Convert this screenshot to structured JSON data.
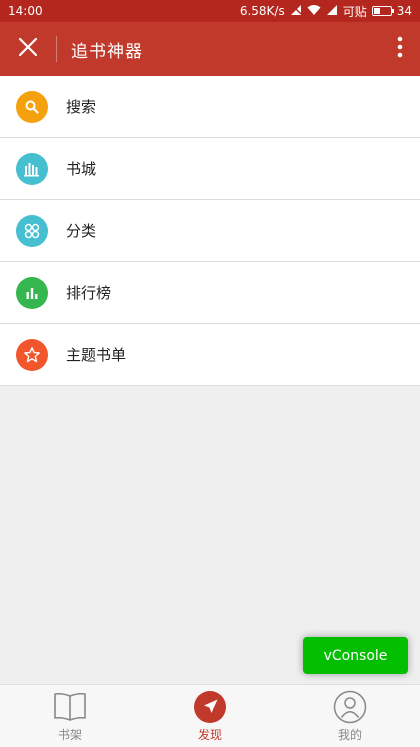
{
  "status_bar": {
    "time": "14:00",
    "net_speed": "6.58K/s",
    "carrier": "可贴",
    "battery": "34"
  },
  "title_bar": {
    "title": "追书神器"
  },
  "menu": {
    "items": [
      {
        "label": "搜索",
        "icon": "search-icon",
        "color": "#f5a10e"
      },
      {
        "label": "书城",
        "icon": "bookstore-icon",
        "color": "#46bfd1"
      },
      {
        "label": "分类",
        "icon": "category-icon",
        "color": "#46bfd1"
      },
      {
        "label": "排行榜",
        "icon": "ranking-icon",
        "color": "#36b64f"
      },
      {
        "label": "主题书单",
        "icon": "star-icon",
        "color": "#f2562d"
      }
    ]
  },
  "vconsole": {
    "label": "vConsole",
    "color": "#04be02"
  },
  "tabs": [
    {
      "label": "书架",
      "icon": "book-icon",
      "active": false
    },
    {
      "label": "发现",
      "icon": "compass-icon",
      "active": true
    },
    {
      "label": "我的",
      "icon": "user-icon",
      "active": false
    }
  ],
  "colors": {
    "accent": "#c0392b",
    "status_bar": "#b3271f"
  }
}
